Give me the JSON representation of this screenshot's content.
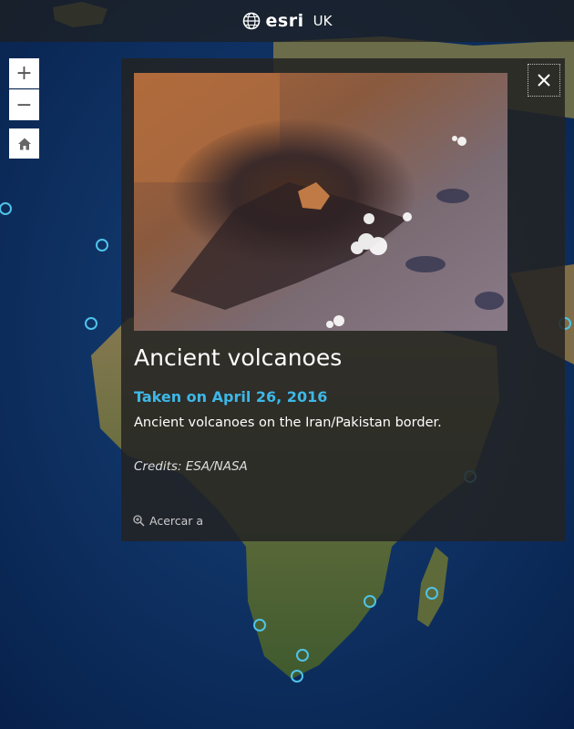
{
  "header": {
    "brand": "esri",
    "region": "UK"
  },
  "controls": {
    "zoom_in_label": "+",
    "zoom_out_label": "−",
    "home_icon": "home-icon"
  },
  "popup": {
    "title": "Ancient volcanoes",
    "date": "Taken on April 26, 2016",
    "description": "Ancient volcanoes on the Iran/Pakistan border.",
    "credits": "Credits: ESA/NASA",
    "zoom_action": "Acercar a",
    "close_icon": "close-icon",
    "zoom_icon": "magnifier-plus-icon"
  },
  "colors": {
    "accent": "#3db8e8",
    "ocean": "#0b2a55",
    "popup_bg": "#232323",
    "marker": "#4fc3e8"
  }
}
